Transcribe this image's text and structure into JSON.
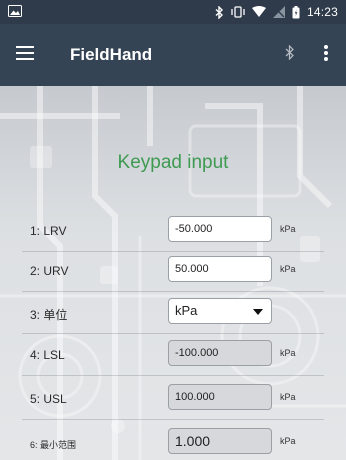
{
  "status": {
    "time": "14:23",
    "icons": [
      "gallery-icon",
      "bluetooth-icon",
      "vibrate-icon",
      "wifi-icon",
      "no-signal-icon",
      "battery-icon"
    ]
  },
  "appbar": {
    "title": "FieldHand",
    "icons": [
      "hamburger-menu-icon",
      "bluetooth-icon",
      "more-vertical-icon"
    ]
  },
  "colors": {
    "status_bar": "#2f3b4a",
    "app_bar": "#354454",
    "heading": "#3f9a52"
  },
  "heading": "Keypad input",
  "rows": [
    {
      "label": "1: LRV",
      "value": "-50.000",
      "unit": "kPa",
      "editable": true
    },
    {
      "label": "2: URV",
      "value": "50.000",
      "unit": "kPa",
      "editable": true
    },
    {
      "label": "3: 单位",
      "value": "kPa",
      "unit": "",
      "editable": true,
      "dropdown": true
    },
    {
      "label": "4: LSL",
      "value": "-100.000",
      "unit": "kPa",
      "editable": false
    },
    {
      "label": "5: USL",
      "value": "100.000",
      "unit": "kPa",
      "editable": false
    },
    {
      "label": "6: 最小范围",
      "value": "1.000",
      "unit": "kPa",
      "editable": false
    }
  ]
}
